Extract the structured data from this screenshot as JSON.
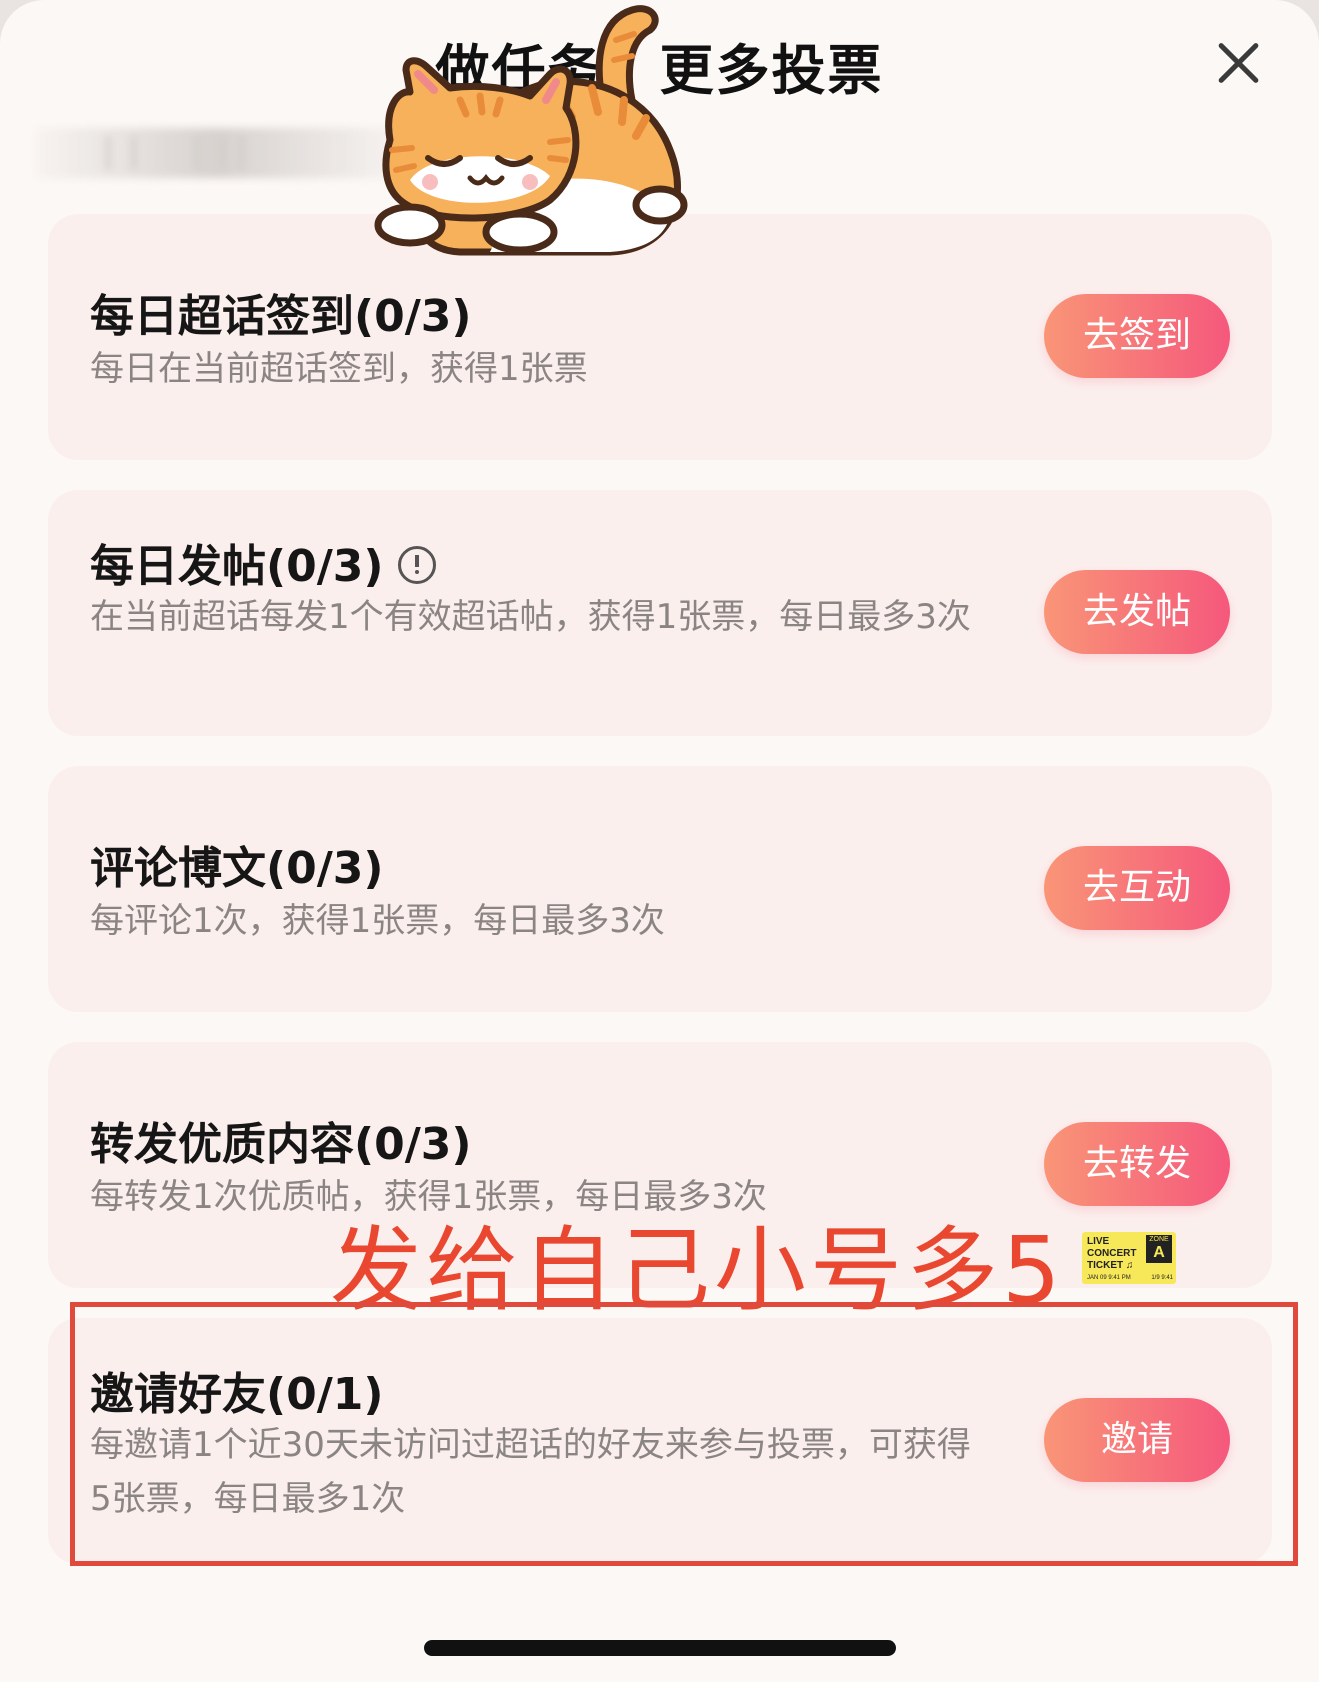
{
  "header": {
    "title": "做任务，更多投票"
  },
  "tasks": [
    {
      "title": "每日超话签到(0/3)",
      "desc": "每日在当前超话签到，获得1张票",
      "button": "去签到"
    },
    {
      "title": "每日发帖(0/3)",
      "desc": "在当前超话每发1个有效超话帖，获得1张票，每日最多3次",
      "button": "去发帖"
    },
    {
      "title": "评论博文(0/3)",
      "desc": "每评论1次，获得1张票，每日最多3次",
      "button": "去互动"
    },
    {
      "title": "转发优质内容(0/3)",
      "desc": "每转发1次优质帖，获得1张票，每日最多3次",
      "button": "去转发"
    },
    {
      "title": "邀请好友(0/1)",
      "desc": "每邀请1个近30天未访问过超话的好友来参与投票，可获得5张票，每日最多1次",
      "button": "邀请"
    }
  ],
  "annotation": {
    "text": "发给自己小号多5",
    "color": "#e9472f",
    "sticker": {
      "line1": "LIVE",
      "line2": "CONCERT",
      "line3": "TICKET ♫",
      "zone_label": "ZONE",
      "zone": "A",
      "footer_left": "JAN 09  9:41 PM",
      "footer_right": "1/9  9:41"
    }
  },
  "colors": {
    "button_gradient_start": "#f99577",
    "button_gradient_end": "#f5587c",
    "card_background": "#fbefed",
    "annotation_box": "#e04a3c"
  },
  "icons": [
    "close-icon",
    "info-icon",
    "sleeping-cat-sticker",
    "concert-ticket-sticker"
  ]
}
